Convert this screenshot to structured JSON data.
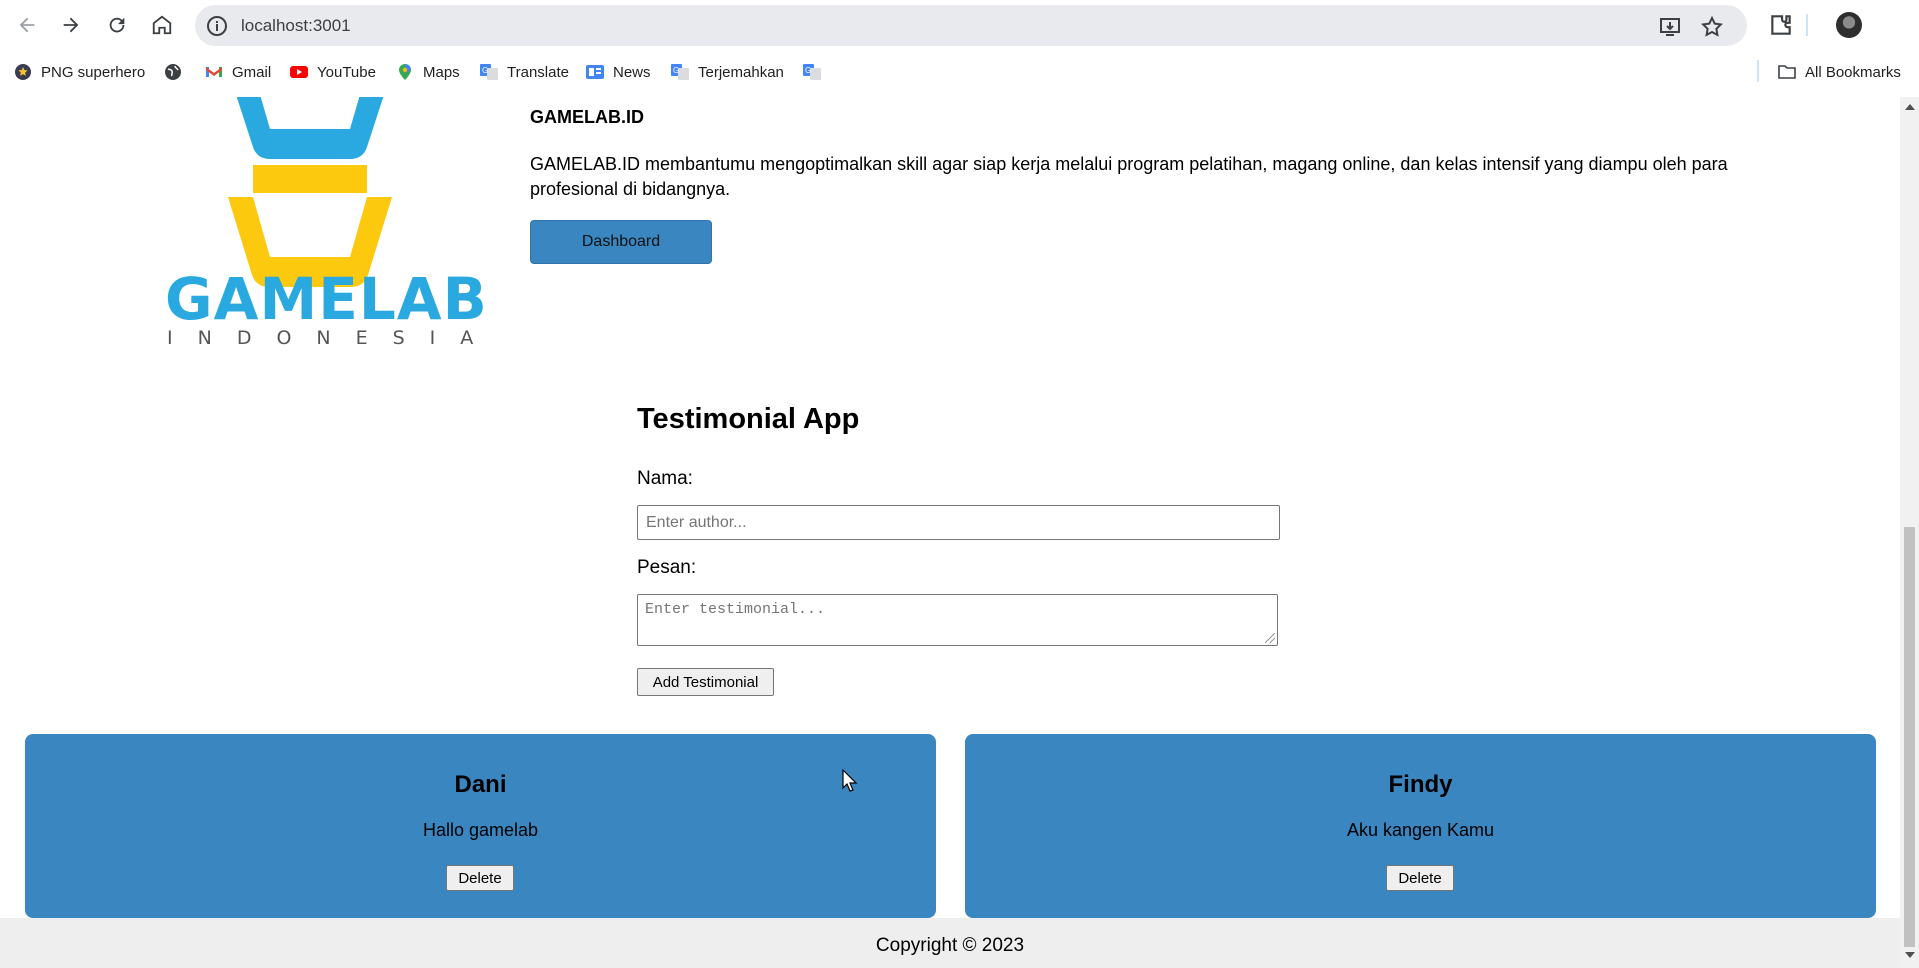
{
  "browser": {
    "url": "localhost:3001",
    "bookmarks": [
      {
        "label": "PNG superhero",
        "icon": "star-badge-icon"
      },
      {
        "label": "",
        "icon": "globe-icon"
      },
      {
        "label": "Gmail",
        "icon": "gmail-icon"
      },
      {
        "label": "YouTube",
        "icon": "youtube-icon"
      },
      {
        "label": "Maps",
        "icon": "maps-pin-icon"
      },
      {
        "label": "Translate",
        "icon": "translate-icon"
      },
      {
        "label": "News",
        "icon": "news-icon"
      },
      {
        "label": "Terjemahkan",
        "icon": "translate-icon"
      },
      {
        "label": "",
        "icon": "translate-icon"
      }
    ],
    "all_bookmarks": "All Bookmarks"
  },
  "header": {
    "logo_word": "GAMELAB",
    "logo_sub": "INDONESIA",
    "title": "GAMELAB.ID",
    "description": "GAMELAB.ID membantumu mengoptimalkan skill agar siap kerja melalui program pelatihan, magang online, dan kelas intensif yang diampu oleh para profesional di bidangnya.",
    "dashboard_label": "Dashboard"
  },
  "form": {
    "title": "Testimonial App",
    "name_label": "Nama:",
    "name_placeholder": "Enter author...",
    "message_label": "Pesan:",
    "message_placeholder": "Enter testimonial...",
    "submit_label": "Add Testimonial"
  },
  "testimonials": [
    {
      "author": "Dani",
      "message": "Hallo gamelab",
      "delete_label": "Delete"
    },
    {
      "author": "Findy",
      "message": "Aku kangen Kamu",
      "delete_label": "Delete"
    }
  ],
  "footer": {
    "copyright": "Copyright © 2023"
  },
  "colors": {
    "accent": "#3a86c1",
    "logo_blue": "#29a9df",
    "logo_yellow": "#fcc90e"
  }
}
